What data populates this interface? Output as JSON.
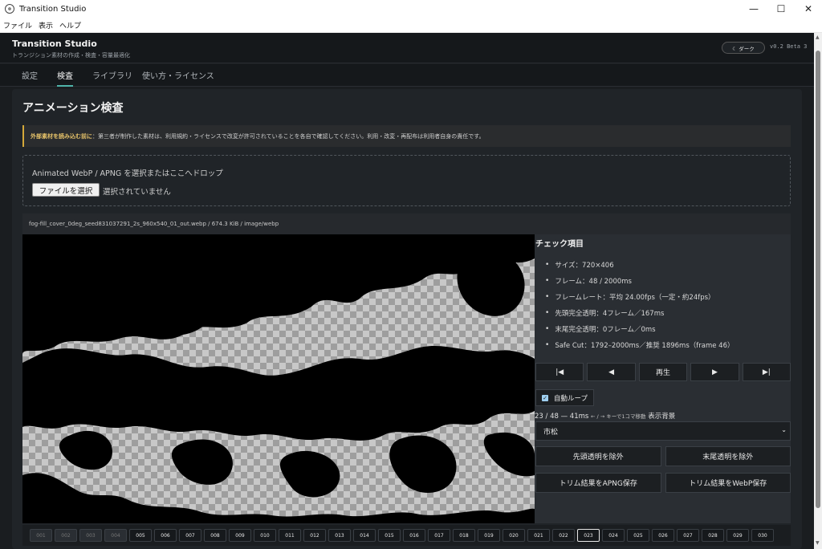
{
  "window": {
    "title": "Transition Studio",
    "minimize": "—",
    "maximize": "☐",
    "close": "✕"
  },
  "menu": [
    "ファイル",
    "表示",
    "ヘルプ"
  ],
  "header": {
    "brand": "Transition Studio",
    "subtitle": "トランジション素材の作成・検査・容量最適化",
    "theme_button": "☾ ダーク",
    "version": "v0.2 Beta 3"
  },
  "tabs": [
    {
      "label": "設定",
      "active": false
    },
    {
      "label": "検査",
      "active": true
    },
    {
      "label": "ライブラリ",
      "active": false
    },
    {
      "label": "使い方・ライセンス",
      "active": false
    }
  ],
  "page_title": "アニメーション検査",
  "notice": {
    "strong": "外部素材を読み込む前に",
    "text": "：第三者が制作した素材は、利用規約・ライセンスで改変が許可されていることを各自で確認してください。利用・改変・再配布は利用者自身の責任です。"
  },
  "dropzone": {
    "label": "Animated WebP / APNG を選択またはここへドロップ",
    "button": "ファイルを選択",
    "status": "選択されていません"
  },
  "file_info": "fog-fill_cover_0deg_seed831037291_2s_960x540_01_out.webp / 674.3 KiB / image/webp",
  "checks": {
    "title": "チェック項目",
    "items": [
      "サイズ：720×406",
      "フレーム：48 / 2000ms",
      "フレームレート：平均 24.00fps（一定・約24fps）",
      "先頭完全透明：4フレーム／167ms",
      "末尾完全透明：0フレーム／0ms",
      "Safe Cut：1792–2000ms／推奨 1896ms（frame 46）"
    ]
  },
  "controls": {
    "first": "|◀",
    "prev": "◀",
    "play": "再生",
    "next": "▶",
    "last": "▶|"
  },
  "loop": {
    "label": "自動ループ",
    "checked": true
  },
  "frame_status": {
    "main": "23 / 48 — 41ms",
    "hint": "← / → キーで1コマ移動",
    "bg_label": "表示背景"
  },
  "background_select": {
    "value": "市松"
  },
  "actions": {
    "remove_head": "先頭透明を除外",
    "remove_tail": "末尾透明を除外",
    "save_apng": "トリム結果をAPNG保存",
    "save_webp": "トリム結果をWebP保存"
  },
  "frames": {
    "labels": [
      "001",
      "002",
      "003",
      "004",
      "005",
      "006",
      "007",
      "008",
      "009",
      "010",
      "011",
      "012",
      "013",
      "014",
      "015",
      "016",
      "017",
      "018",
      "019",
      "020",
      "021",
      "022",
      "023",
      "024",
      "025",
      "026",
      "027",
      "028",
      "029",
      "030"
    ],
    "transparent_count": 4,
    "current": "023"
  }
}
